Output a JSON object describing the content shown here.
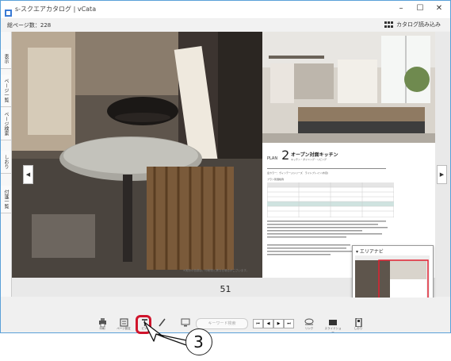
{
  "window": {
    "title": "s-スクエアカタログ | vCata",
    "minimize": "–",
    "maximize": "☐",
    "close": "✕"
  },
  "topbar": {
    "total_pages": "総ページ数：228",
    "add_catalog": "カタログ読み込み"
  },
  "side_tabs": [
    "表示",
    "ページ一覧",
    "ページ検索",
    "しおり",
    "付箋一覧"
  ],
  "nav": {
    "prev": "◀",
    "next": "▶"
  },
  "page": {
    "plan_label": "PLAN",
    "plan_number": "2",
    "plan_title": "オープン対面キッチン",
    "plan_sub": "キッチン・ダイニング・リビング",
    "color_line": "扉カラー：ヴィンテージシリーズ　ライトブレイン(木目)",
    "table_caption": "プラン別価格例",
    "footer_note": "※実際の色調は、印刷物と異なる場合がございます。",
    "number": "51"
  },
  "area_nav": {
    "title": "▾ エリアナビ"
  },
  "toolbar": {
    "print": "印刷",
    "page_setup": "ページ設定",
    "pin": "ピン",
    "pen": "ペン",
    "present": "発表",
    "search_placeholder": "キーワード検索",
    "first": "⏮",
    "prev": "◀",
    "next": "▶",
    "last": "⏭",
    "link": "リンク",
    "slideshow": "スライドショー",
    "bookmark": "しおり"
  },
  "callout": {
    "number": "3"
  },
  "colors": {
    "highlight": "#d0152c",
    "window_border": "#5aa0d8"
  }
}
